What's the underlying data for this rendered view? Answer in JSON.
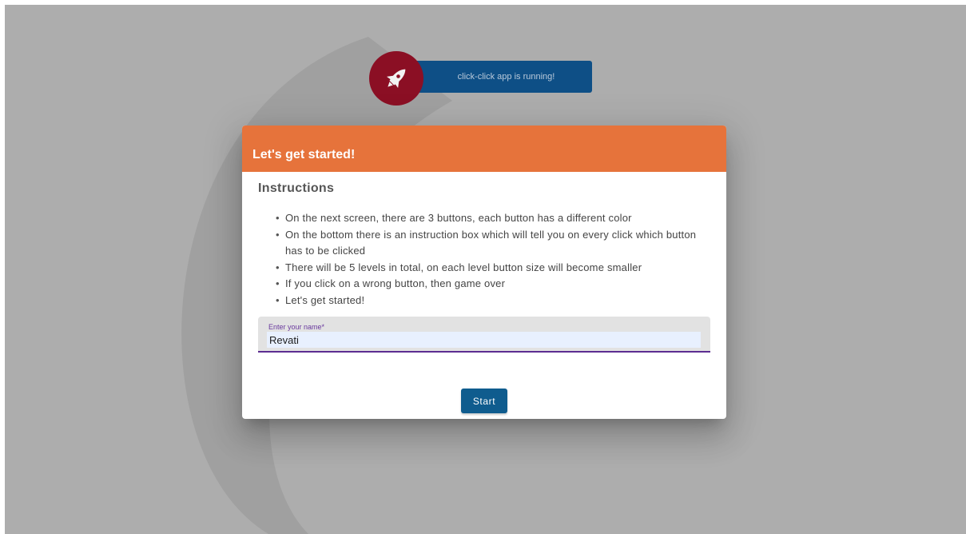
{
  "banner": {
    "text": "click-click app is running!",
    "icon": "rocket-icon",
    "bar_color": "#0e4f86",
    "circle_color": "#8b0f24"
  },
  "dialog": {
    "title": "Let's get started!",
    "header_color": "#e6733b",
    "instructions_heading": "Instructions",
    "instructions": [
      "On the next screen, there are 3 buttons, each button has a different color",
      "On the bottom there is an instruction box which will tell you on every click which button has to be clicked",
      "There will be 5 levels in total, on each level button size will become smaller",
      "If you click on a wrong button, then game over",
      "Let's get started!"
    ],
    "name_field": {
      "label": "Enter your name*",
      "value": "Revati"
    },
    "start_label": "Start",
    "start_color": "#0f5c8e"
  }
}
